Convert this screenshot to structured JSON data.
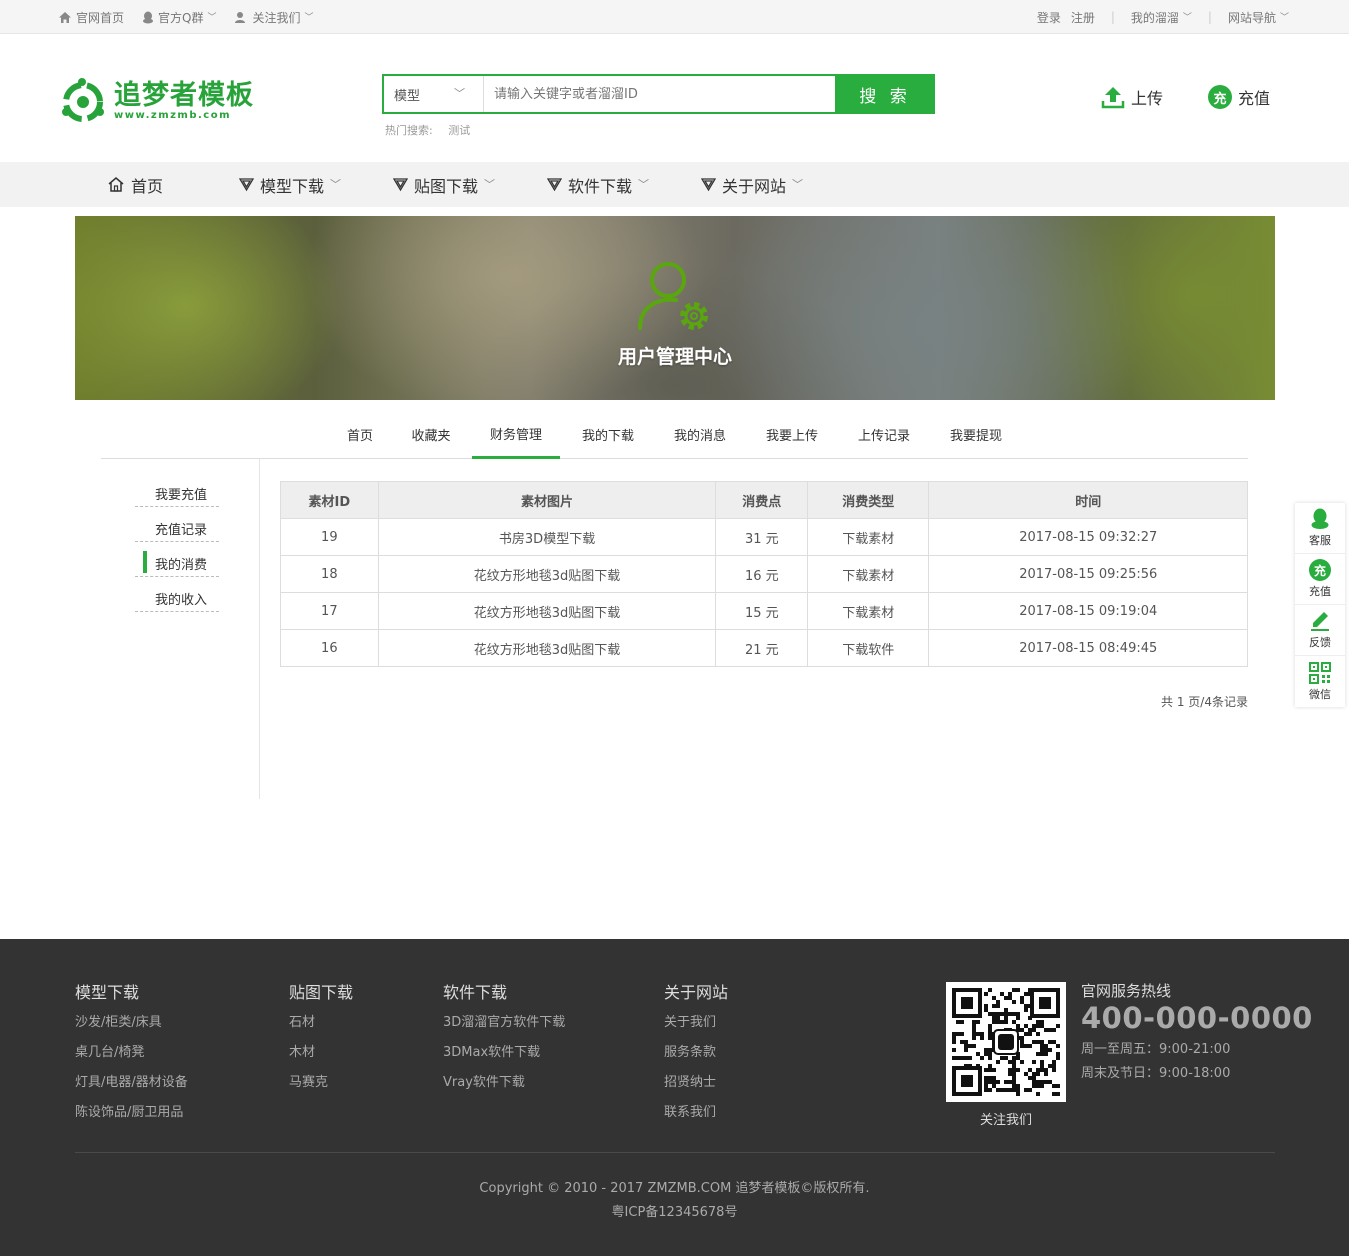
{
  "topbar": {
    "home": "官网首页",
    "qq_group": "官方Q群",
    "follow": "关注我们",
    "login": "登录",
    "register": "注册",
    "my_account": "我的溜溜",
    "site_nav": "网站导航"
  },
  "logo": {
    "cn": "追梦者模板",
    "en": "www.zmzmb.com"
  },
  "search": {
    "category": "模型",
    "placeholder": "请输入关键字或者溜溜ID",
    "button": "搜 索",
    "hot_label": "热门搜索:",
    "hot_keyword": "测试"
  },
  "header_actions": {
    "upload": "上传",
    "recharge": "充值",
    "recharge_badge": "充"
  },
  "nav": [
    "首页",
    "模型下载",
    "贴图下载",
    "软件下载",
    "关于网站"
  ],
  "banner": {
    "title": "用户管理中心"
  },
  "tabs": [
    "首页",
    "收藏夹",
    "财务管理",
    "我的下载",
    "我的消息",
    "我要上传",
    "上传记录",
    "我要提现"
  ],
  "active_tab": "财务管理",
  "sidebar": [
    "我要充值",
    "充值记录",
    "我的消费",
    "我的收入"
  ],
  "table": {
    "headers": [
      "素材ID",
      "素材图片",
      "消费点",
      "消费类型",
      "时间"
    ],
    "rows": [
      [
        "19",
        "书房3D模型下载",
        "31 元",
        "下载素材",
        "2017-08-15 09:32:27"
      ],
      [
        "18",
        "花纹方形地毯3d贴图下载",
        "16 元",
        "下载素材",
        "2017-08-15 09:25:56"
      ],
      [
        "17",
        "花纹方形地毯3d贴图下载",
        "15 元",
        "下载素材",
        "2017-08-15 09:19:04"
      ],
      [
        "16",
        "花纹方形地毯3d贴图下载",
        "21 元",
        "下载软件",
        "2017-08-15 08:49:45"
      ]
    ],
    "pager": "共 1 页/4条记录"
  },
  "float_bar": [
    "客服",
    "充值",
    "反馈",
    "微信"
  ],
  "footer": {
    "cols": [
      {
        "title": "模型下载",
        "links": [
          "沙发/柜类/床具",
          "桌几台/椅凳",
          "灯具/电器/器材设备",
          "陈设饰品/厨卫用品"
        ]
      },
      {
        "title": "贴图下载",
        "links": [
          "石材",
          "木材",
          "马赛克"
        ]
      },
      {
        "title": "软件下载",
        "links": [
          "3D溜溜官方软件下载",
          "3DMax软件下载",
          "Vray软件下载"
        ]
      },
      {
        "title": "关于网站",
        "links": [
          "关于我们",
          "服务条款",
          "招贤纳士",
          "联系我们"
        ]
      }
    ],
    "qr_caption": "关注我们",
    "hotline_title": "官网服务热线",
    "phone": "400-000-0000",
    "weekday": "周一至周五：9:00-21:00",
    "weekend": "周末及节日：9:00-18:00",
    "copyright": "Copyright © 2010 - 2017 ZMZMB.COM 追梦者模板©版权所有.",
    "icp": "粤ICP备12345678号"
  },
  "colors": {
    "brand_green": "#2aad3f",
    "footer_bg": "#333333"
  }
}
